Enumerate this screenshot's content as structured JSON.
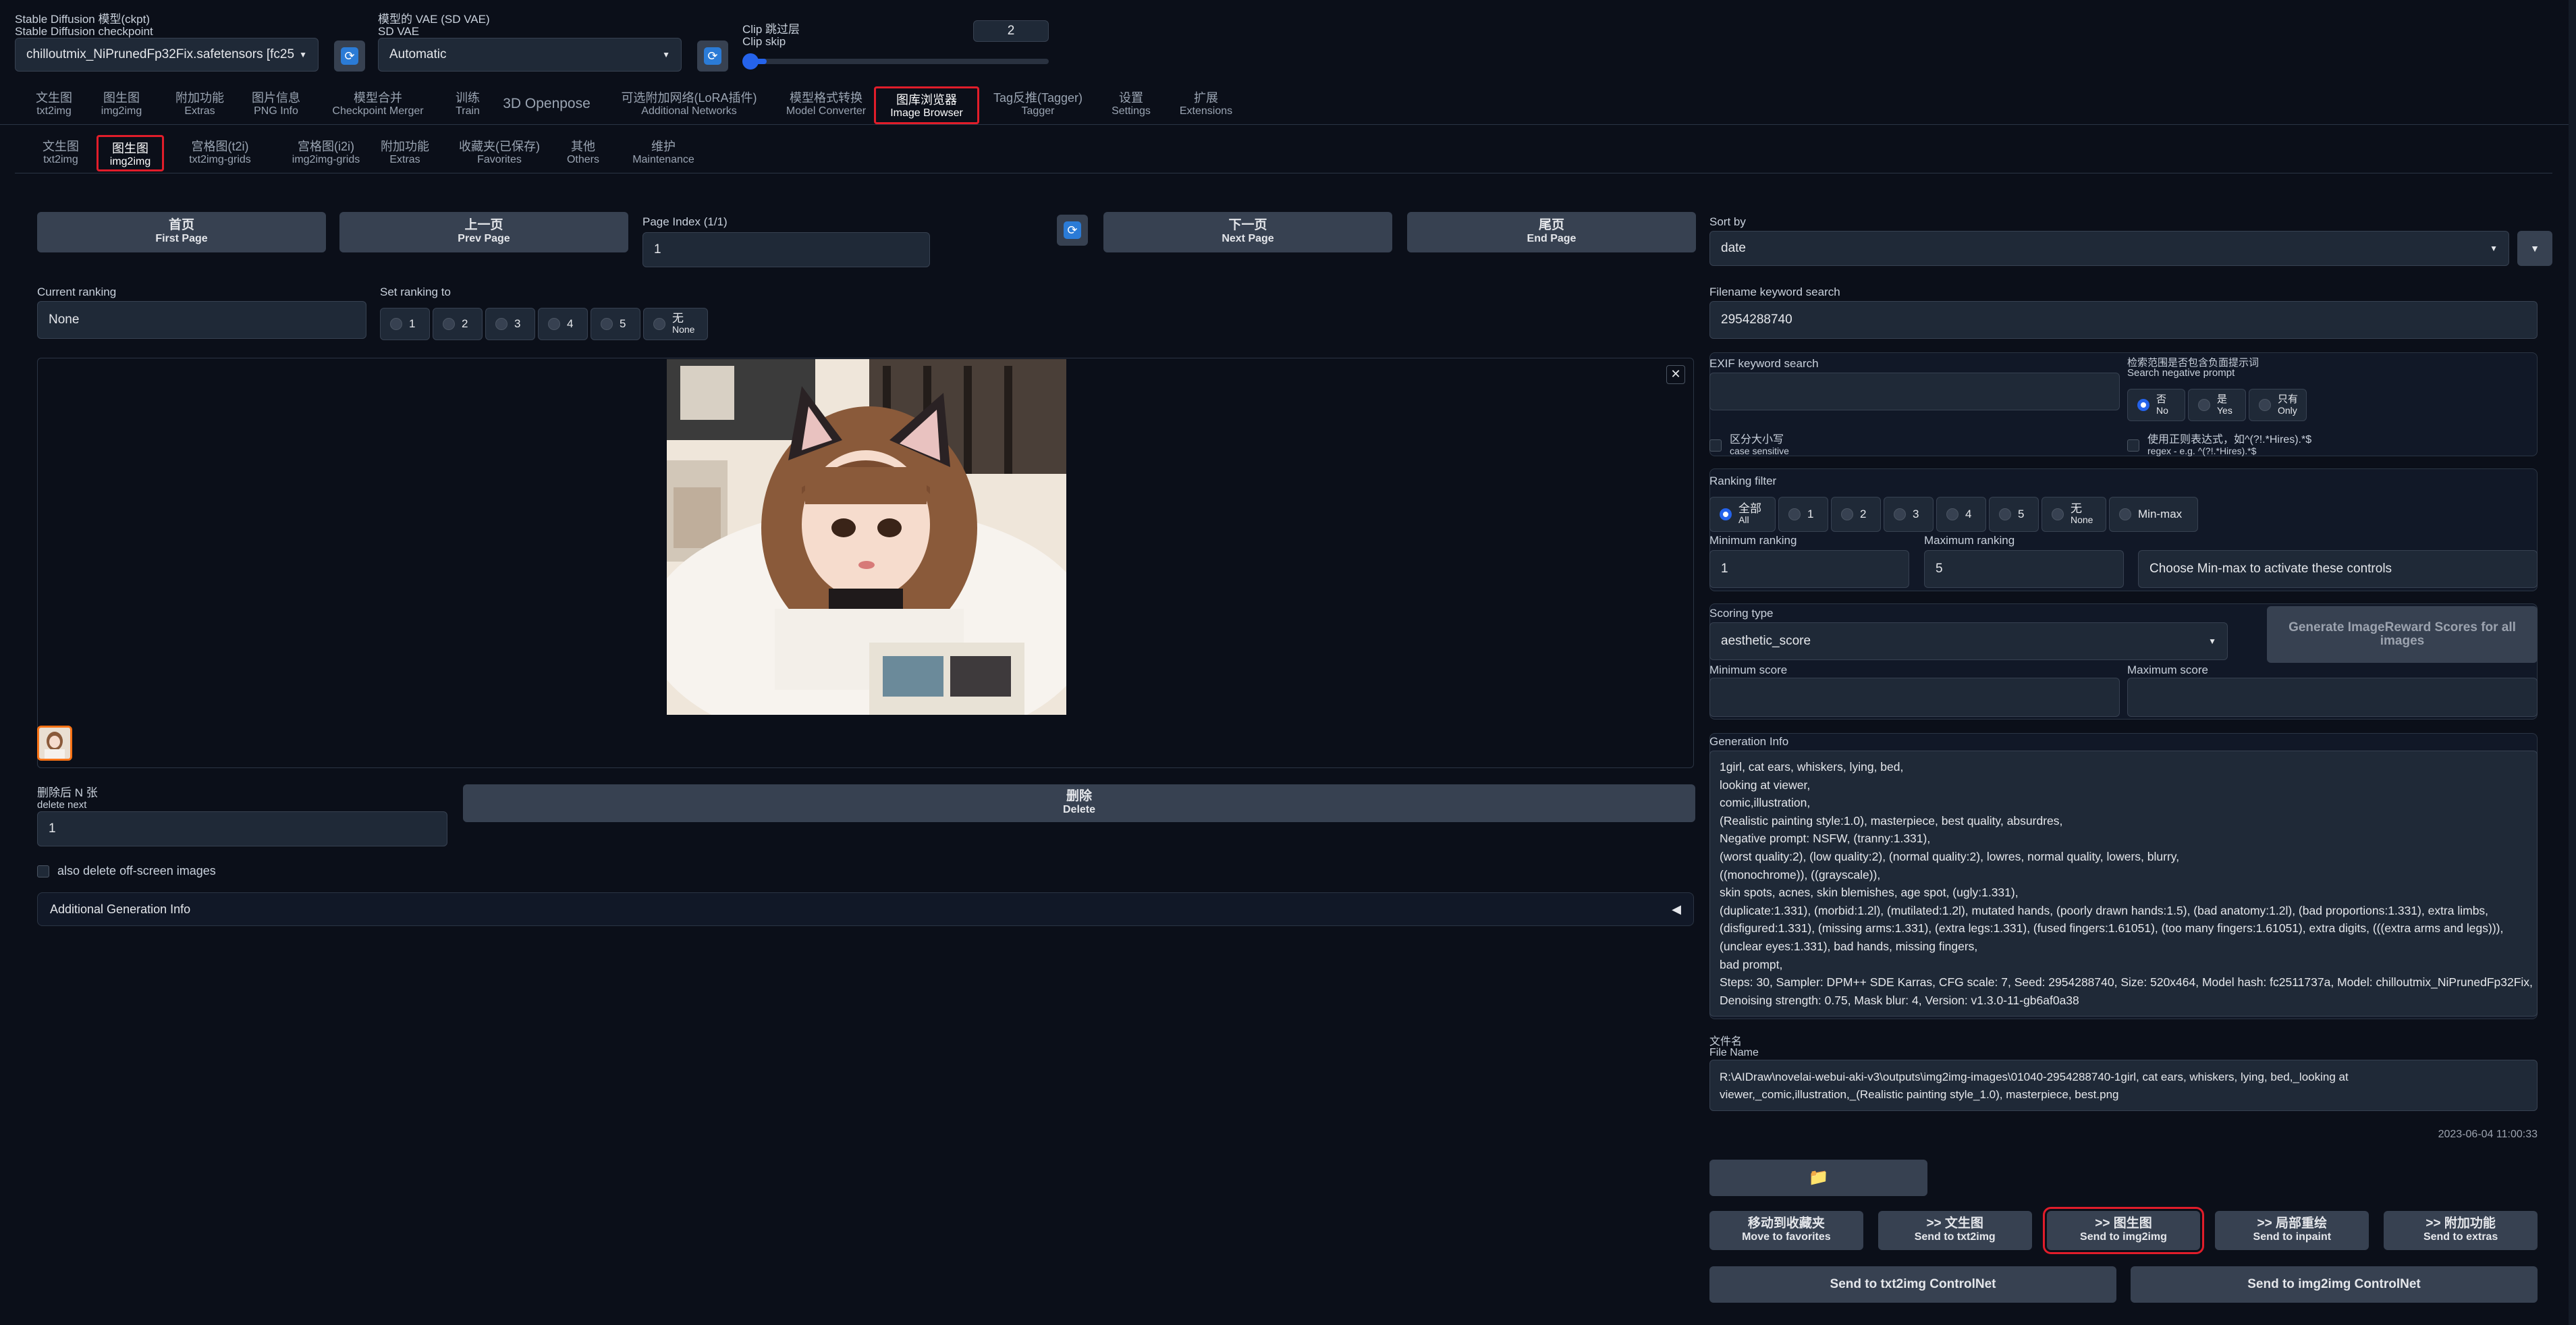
{
  "top": {
    "ckpt_label": "Stable Diffusion 模型(ckpt)",
    "ckpt_label_en": "Stable Diffusion checkpoint",
    "ckpt_value": "chilloutmix_NiPrunedFp32Fix.safetensors [fc25",
    "vae_label": "模型的 VAE (SD VAE)",
    "vae_label_en": "SD VAE",
    "vae_value": "Automatic",
    "clip_label": "Clip 跳过层",
    "clip_label_en": "Clip skip",
    "clip_value": "2",
    "clip_min": 1,
    "clip_max": 12
  },
  "main_tabs": [
    {
      "zh": "文生图",
      "en": "txt2img"
    },
    {
      "zh": "图生图",
      "en": "img2img"
    },
    {
      "zh": "附加功能",
      "en": "Extras"
    },
    {
      "zh": "图片信息",
      "en": "PNG Info"
    },
    {
      "zh": "模型合并",
      "en": "Checkpoint Merger"
    },
    {
      "zh": "训练",
      "en": "Train"
    },
    {
      "zh": "3D Openpose",
      "en": ""
    },
    {
      "zh": "可选附加网络(LoRA插件)",
      "en": "Additional Networks"
    },
    {
      "zh": "模型格式转换",
      "en": "Model Converter"
    },
    {
      "zh": "图库浏览器",
      "en": "Image Browser"
    },
    {
      "zh": "Tag反推(Tagger)",
      "en": "Tagger"
    },
    {
      "zh": "设置",
      "en": "Settings"
    },
    {
      "zh": "扩展",
      "en": "Extensions"
    }
  ],
  "sub_tabs": [
    {
      "zh": "文生图",
      "en": "txt2img"
    },
    {
      "zh": "图生图",
      "en": "img2img"
    },
    {
      "zh": "宫格图(t2i)",
      "en": "txt2img-grids"
    },
    {
      "zh": "宫格图(i2i)",
      "en": "img2img-grids"
    },
    {
      "zh": "附加功能",
      "en": "Extras"
    },
    {
      "zh": "收藏夹(已保存)",
      "en": "Favorites"
    },
    {
      "zh": "其他",
      "en": "Others"
    },
    {
      "zh": "维护",
      "en": "Maintenance"
    }
  ],
  "nav": {
    "first_zh": "首页",
    "first_en": "First Page",
    "prev_zh": "上一页",
    "prev_en": "Prev Page",
    "page_index_label": "Page Index (1/1)",
    "page_index_value": "1",
    "next_zh": "下一页",
    "next_en": "Next Page",
    "end_zh": "尾页",
    "end_en": "End Page"
  },
  "ranking": {
    "current_label": "Current ranking",
    "current_value": "None",
    "set_label": "Set ranking to",
    "options": [
      "1",
      "2",
      "3",
      "4",
      "5"
    ],
    "none_zh": "无",
    "none_en": "None"
  },
  "delete": {
    "label_zh": "删除后 N 张",
    "label_en": "delete next",
    "value": "1",
    "btn_zh": "删除",
    "btn_en": "Delete",
    "also_label": "also delete off-screen images",
    "additional_info": "Additional Generation Info"
  },
  "right": {
    "sort_label": "Sort by",
    "sort_value": "date",
    "filename_label": "Filename keyword search",
    "filename_value": "2954288740",
    "exif_label": "EXIF keyword search",
    "exif_value": "",
    "neg_label_zh": "检索范围是否包含负面提示词",
    "neg_label_en": "Search negative prompt",
    "neg_opts": [
      {
        "zh": "否",
        "en": "No"
      },
      {
        "zh": "是",
        "en": "Yes"
      },
      {
        "zh": "只有",
        "en": "Only"
      }
    ],
    "case_zh": "区分大小写",
    "case_en": "case sensitive",
    "regex_zh": "使用正则表达式，如^(?!.*Hires).*$",
    "regex_en": "regex - e.g. ^(?!.*Hires).*$",
    "rank_filter_label": "Ranking filter",
    "rank_filter_all_zh": "全部",
    "rank_filter_all_en": "All",
    "rank_filter_opts": [
      "1",
      "2",
      "3",
      "4",
      "5"
    ],
    "rank_filter_none_zh": "无",
    "rank_filter_none_en": "None",
    "rank_filter_minmax": "Min-max",
    "min_rank_label": "Minimum ranking",
    "min_rank_value": "1",
    "max_rank_label": "Maximum ranking",
    "max_rank_value": "5",
    "minmax_hint": "Choose Min-max to activate these controls",
    "scoring_label": "Scoring type",
    "scoring_value": "aesthetic_score",
    "gen_scores_btn": "Generate ImageReward Scores for all images",
    "min_score_label": "Minimum score",
    "max_score_label": "Maximum score",
    "geninfo_label": "Generation Info",
    "geninfo_lines": [
      "1girl, cat ears, whiskers, lying, bed,",
      "looking at viewer,",
      "comic,illustration,",
      "(Realistic painting style:1.0), masterpiece, best quality, absurdres,",
      "Negative prompt: NSFW, (tranny:1.331),",
      "(worst quality:2), (low quality:2), (normal quality:2), lowres, normal quality, lowers, blurry,",
      "((monochrome)), ((grayscale)),",
      "skin spots, acnes, skin blemishes, age spot, (ugly:1.331),",
      "(duplicate:1.331), (morbid:1.2l), (mutilated:1.2l), mutated hands, (poorly drawn hands:1.5), (bad anatomy:1.2l), (bad proportions:1.331), extra limbs,",
      "(disfigured:1.331), (missing arms:1.331), (extra legs:1.331), (fused fingers:1.61051), (too many fingers:1.61051), extra digits, (((extra arms and legs))),",
      "(unclear eyes:1.331), bad hands, missing fingers,",
      "bad prompt,",
      "Steps: 30, Sampler: DPM++ SDE Karras, CFG scale: 7, Seed: 2954288740, Size: 520x464, Model hash: fc2511737a, Model: chilloutmix_NiPrunedFp32Fix,",
      "Denoising strength: 0.75, Mask blur: 4, Version: v1.3.0-11-gb6af0a38"
    ],
    "filename_title_zh": "文件名",
    "filename_title_en": "File Name",
    "file_path_1": "R:\\AIDraw\\novelai-webui-aki-v3\\outputs\\img2img-images\\01040-2954288740-1girl, cat ears, whiskers, lying, bed,_looking at",
    "file_path_2": "viewer,_comic,illustration,_(Realistic painting style_1.0), masterpiece, best.png",
    "timestamp": "2023-06-04 11:00:33",
    "folder_icon": "📁",
    "send": [
      {
        "zh": "移动到收藏夹",
        "en": "Move to favorites"
      },
      {
        "zh": ">> 文生图",
        "en": "Send to txt2img"
      },
      {
        "zh": ">> 图生图",
        "en": "Send to img2img"
      },
      {
        "zh": ">> 局部重绘",
        "en": "Send to inpaint"
      },
      {
        "zh": ">> 附加功能",
        "en": "Send to extras"
      }
    ],
    "controlnet_txt": "Send to txt2img ControlNet",
    "controlnet_img": "Send to img2img ControlNet"
  },
  "colors": {
    "accent": "#2563eb",
    "highlight": "#e11d2a",
    "bg": "#0b0f19"
  }
}
